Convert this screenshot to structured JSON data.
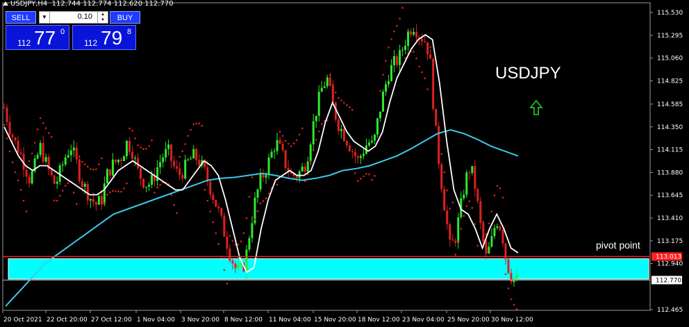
{
  "header": {
    "symbol_timeframe": "USDJPY,H4",
    "ohlc": "112.744 112.774 112.620 112.770"
  },
  "trade_panel": {
    "sell_label": "SELL",
    "buy_label": "BUY",
    "lot": "0.10",
    "bid_prefix": "112",
    "bid_big": "77",
    "bid_sup": "0",
    "ask_prefix": "112",
    "ask_big": "79",
    "ask_sup": "8",
    "sell_color": "#1e3cff",
    "buy_color": "#1e3cff"
  },
  "annotations": {
    "instrument": "USDJPY",
    "pivot_label": "pivot point",
    "arrow_icon": "up-arrow-icon",
    "arrow_color": "#1fbf1f"
  },
  "colors": {
    "bull": "#2ee82e",
    "bear": "#e02020",
    "psar": "#e02020",
    "fast_ma": "#ffffff",
    "slow_ma": "#3ec8e8",
    "zone": "#00ffff",
    "pivot_line": "#ff2020"
  },
  "chart_data": {
    "type": "candlestick",
    "ylim": [
      112.4,
      115.6
    ],
    "y_ticks": [
      "115.530",
      "115.295",
      "115.060",
      "114.825",
      "114.585",
      "114.350",
      "114.115",
      "113.880",
      "113.645",
      "113.410",
      "113.175",
      "112.940",
      "112.465"
    ],
    "x_ticks": [
      "20 Oct 2021",
      "22 Oct 20:00",
      "27 Oct 12:00",
      "1 Nov 04:00",
      "3 Nov 20:00",
      "8 Nov 12:00",
      "11 Nov 04:00",
      "15 Nov 20:00",
      "18 Nov 12:00",
      "23 Nov 04:00",
      "25 Nov 20:00",
      "30 Nov 12:00"
    ],
    "pivot_point": 113.013,
    "pivot_label": "113.013",
    "current_price": 112.77,
    "current_label": "112.770",
    "zone": [
      112.78,
      112.99
    ],
    "close_path": [
      114.55,
      114.35,
      114.2,
      114.1,
      113.95,
      113.8,
      113.95,
      114.15,
      114.0,
      113.85,
      113.75,
      113.9,
      114.05,
      114.15,
      114.0,
      113.8,
      113.7,
      113.6,
      113.55,
      113.6,
      113.85,
      113.95,
      114.0,
      114.05,
      114.2,
      114.1,
      113.9,
      113.8,
      113.75,
      113.8,
      113.95,
      114.05,
      114.1,
      113.95,
      113.85,
      113.9,
      114.0,
      114.05,
      114.0,
      113.9,
      113.75,
      113.6,
      113.45,
      113.25,
      113.05,
      112.9,
      112.85,
      112.95,
      113.3,
      113.6,
      113.8,
      113.9,
      114.05,
      114.2,
      114.1,
      113.95,
      113.85,
      113.85,
      113.9,
      114.0,
      114.3,
      114.55,
      114.75,
      114.85,
      114.6,
      114.4,
      114.3,
      114.2,
      114.1,
      114.0,
      114.1,
      114.2,
      114.15,
      114.45,
      114.7,
      114.9,
      115.0,
      115.05,
      115.2,
      115.35,
      115.4,
      115.3,
      115.25,
      115.1,
      114.4,
      113.9,
      113.5,
      113.1,
      113.2,
      113.5,
      113.8,
      113.95,
      113.7,
      113.3,
      113.0,
      113.15,
      113.4,
      113.3,
      112.95,
      112.8,
      112.77
    ],
    "slow_ma": [
      112.5,
      112.65,
      112.8,
      112.95,
      113.05,
      113.15,
      113.25,
      113.35,
      113.45,
      113.5,
      113.55,
      113.6,
      113.65,
      113.7,
      113.75,
      113.8,
      113.82,
      113.83,
      113.85,
      113.87,
      113.85,
      113.82,
      113.8,
      113.82,
      113.85,
      113.9,
      113.92,
      113.95,
      114.0,
      114.05,
      114.12,
      114.2,
      114.28,
      114.32,
      114.28,
      114.22,
      114.15,
      114.1,
      114.05
    ],
    "fast_ma": [
      114.35,
      114.2,
      114.05,
      113.95,
      113.9,
      113.95,
      113.95,
      113.9,
      113.85,
      113.8,
      113.75,
      113.7,
      113.65,
      113.65,
      113.7,
      113.8,
      113.9,
      113.95,
      114.0,
      113.95,
      113.9,
      113.85,
      113.8,
      113.75,
      113.7,
      113.7,
      113.8,
      113.9,
      114.0,
      113.95,
      113.85,
      113.6,
      113.3,
      113.0,
      112.85,
      112.9,
      113.3,
      113.6,
      113.8,
      113.85,
      113.9,
      113.85,
      113.85,
      113.9,
      114.1,
      114.4,
      114.6,
      114.45,
      114.3,
      114.2,
      114.15,
      114.1,
      114.15,
      114.3,
      114.6,
      114.85,
      115.0,
      115.15,
      115.25,
      115.3,
      115.25,
      114.8,
      114.2,
      113.7,
      113.5,
      113.45,
      113.3,
      113.1,
      113.3,
      113.45,
      113.3,
      113.1,
      113.05
    ]
  }
}
